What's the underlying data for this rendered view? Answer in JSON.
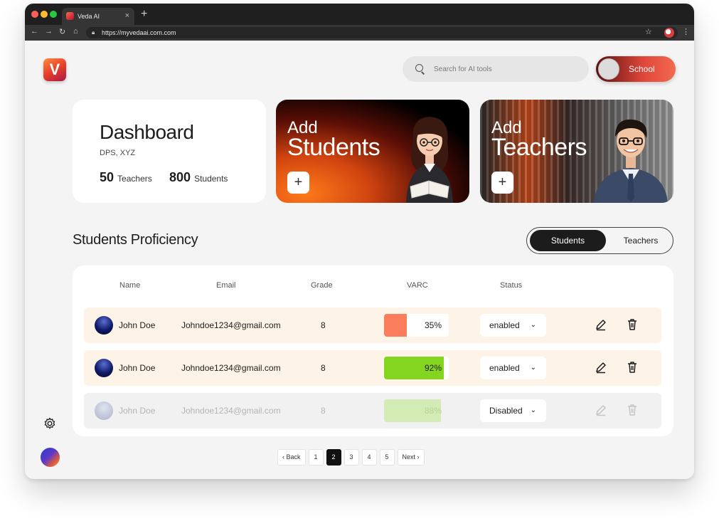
{
  "browser": {
    "tab_title": "Veda AI",
    "tab_close": "×",
    "new_tab": "+",
    "url": "https://myvedaai.com.com"
  },
  "header": {
    "logo_letter": "V",
    "search_placeholder": "Search for AI tools",
    "toggle_label": "School"
  },
  "dashboard": {
    "title": "Dashboard",
    "subtitle": "DPS, XYZ",
    "teachers_count": "50",
    "teachers_label": "Teachers",
    "students_count": "800",
    "students_label": "Students"
  },
  "cards": {
    "students": {
      "line1": "Add",
      "line2": "Students",
      "plus": "+"
    },
    "teachers": {
      "line1": "Add",
      "line2": "Teachers",
      "plus": "+"
    }
  },
  "proficiency": {
    "title": "Students Proficiency",
    "tabs": [
      "Students",
      "Teachers"
    ],
    "columns": [
      "Name",
      "Email",
      "Grade",
      "VARC",
      "Status"
    ],
    "rows": [
      {
        "name": "John Doe",
        "email": "Johndoe1234@gmail.com",
        "grade": "8",
        "varc": "35%",
        "varc_value": 35,
        "status": "enabled",
        "state": "enabled"
      },
      {
        "name": "John Doe",
        "email": "Johndoe1234@gmail.com",
        "grade": "8",
        "varc": "92%",
        "varc_value": 92,
        "status": "enabled",
        "state": "enabled"
      },
      {
        "name": "John Doe",
        "email": "Johndoe1234@gmail.com",
        "grade": "8",
        "varc": "88%",
        "varc_value": 88,
        "status": "Disabled",
        "state": "disabled"
      }
    ]
  },
  "pagination": {
    "back": "Back",
    "next": "Next",
    "pages": [
      "1",
      "2",
      "3",
      "4",
      "5"
    ],
    "current": "2"
  },
  "colors": {
    "accent": "#e0473a",
    "row_enabled_bg": "#fdf3e6",
    "row_disabled_bg": "#f1f1f1",
    "varc_low": "#fa7e5c",
    "varc_high": "#84d51f",
    "varc_high_faded": "#d3ebb5"
  }
}
